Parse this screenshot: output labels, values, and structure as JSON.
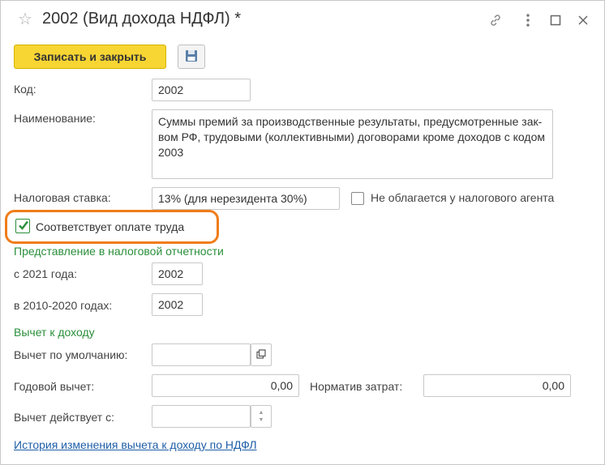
{
  "window": {
    "title": "2002 (Вид дохода НДФЛ) *"
  },
  "toolbar": {
    "save_close_label": "Записать и закрыть"
  },
  "form": {
    "code_label": "Код:",
    "code_value": "2002",
    "name_label": "Наименование:",
    "name_value": "Суммы премий за производственные результаты, предусмотренные зак-вом РФ, трудовыми (коллективными) договорами кроме доходов с кодом 2003",
    "tax_rate_label": "Налоговая ставка:",
    "tax_rate_value": "13% (для нерезидента 30%)",
    "not_taxed_label": "Не облагается у налогового агента",
    "not_taxed_checked": false,
    "labor_pay_label": "Соответствует оплате труда",
    "labor_pay_checked": true
  },
  "reporting": {
    "section_title": "Представление в налоговой отчетности",
    "since_2021_label": "с 2021 года:",
    "since_2021_value": "2002",
    "years_2010_2020_label": "в 2010-2020 годах:",
    "years_2010_2020_value": "2002"
  },
  "deduction": {
    "section_title": "Вычет к доходу",
    "default_label": "Вычет по умолчанию:",
    "default_value": "",
    "annual_label": "Годовой вычет:",
    "annual_value": "0,00",
    "expense_norm_label": "Норматив затрат:",
    "expense_norm_value": "0,00",
    "effective_from_label": "Вычет действует с:",
    "effective_from_value": "",
    "history_link": "История изменения вычета к доходу по НДФЛ"
  },
  "colors": {
    "accent_button": "#f7d533",
    "section_green": "#2a8f3b",
    "link_blue": "#1f5fa8",
    "highlight_orange": "#f07c19"
  }
}
